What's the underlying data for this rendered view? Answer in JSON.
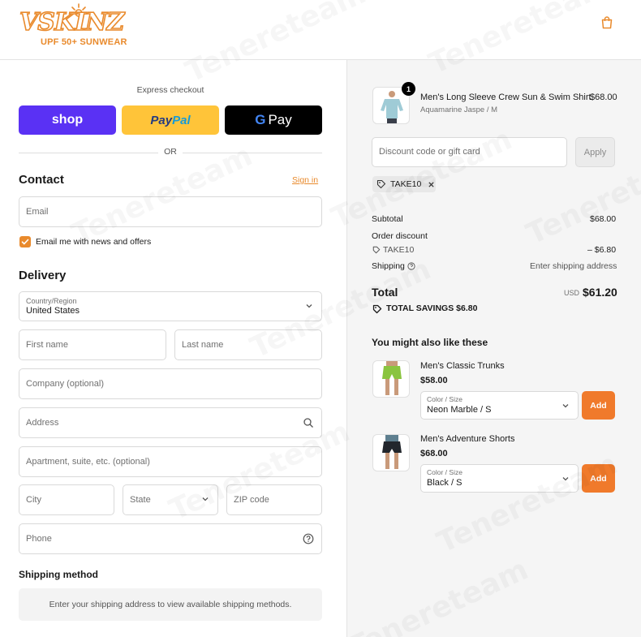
{
  "brand": {
    "logo_word": "VSKINZ",
    "tagline": "UPF 50+ SUNWEAR",
    "accent": "#e98a2c"
  },
  "watermark": "Tenereteam",
  "express": {
    "label": "Express checkout",
    "shop_label": "shop",
    "paypal_label_1": "Pay",
    "paypal_label_2": "Pal",
    "gpay_g": "G",
    "gpay_label": "Pay",
    "or_label": "OR"
  },
  "contact": {
    "title": "Contact",
    "signin_label": "Sign in",
    "email_placeholder": "Email",
    "newsletter_label": "Email me with news and offers",
    "newsletter_checked": true
  },
  "delivery": {
    "title": "Delivery",
    "country_label": "Country/Region",
    "country_value": "United States",
    "first_name_placeholder": "First name",
    "last_name_placeholder": "Last name",
    "company_placeholder": "Company (optional)",
    "address_placeholder": "Address",
    "apartment_placeholder": "Apartment, suite, etc. (optional)",
    "city_placeholder": "City",
    "state_placeholder": "State",
    "zip_placeholder": "ZIP code",
    "phone_placeholder": "Phone"
  },
  "shipping_method": {
    "title": "Shipping method",
    "message": "Enter your shipping address to view available shipping methods."
  },
  "cart": {
    "item": {
      "name": "Men's Long Sleeve Crew Sun & Swim Shirt",
      "variant": "Aquamarine Jaspe / M",
      "price": "$68.00",
      "quantity": "1"
    },
    "discount_placeholder": "Discount code or gift card",
    "apply_label": "Apply",
    "applied_code": "TAKE10"
  },
  "summary": {
    "subtotal_label": "Subtotal",
    "subtotal_value": "$68.00",
    "order_discount_label": "Order discount",
    "discount_code": "TAKE10",
    "discount_value": "– $6.80",
    "shipping_label": "Shipping",
    "shipping_value": "Enter shipping address",
    "total_label": "Total",
    "currency": "USD",
    "total_value": "$61.20",
    "savings_label": "TOTAL SAVINGS",
    "savings_value": "$6.80"
  },
  "upsell": {
    "title": "You might also like these",
    "items": [
      {
        "name": "Men's Classic Trunks",
        "price": "$58.00",
        "variant_label": "Color / Size",
        "variant_value": "Neon Marble / S",
        "add_label": "Add"
      },
      {
        "name": "Men's Adventure Shorts",
        "price": "$68.00",
        "variant_label": "Color / Size",
        "variant_value": "Black / S",
        "add_label": "Add"
      }
    ]
  }
}
